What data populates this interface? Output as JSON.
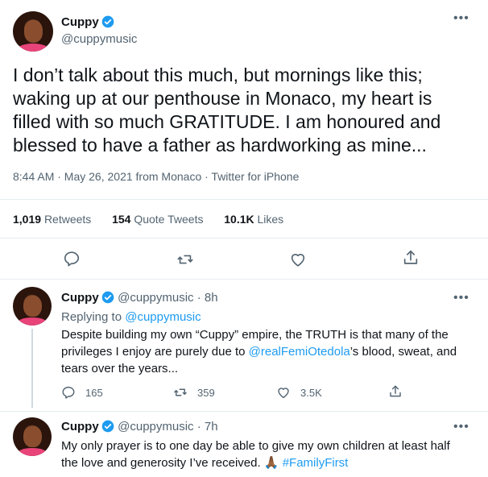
{
  "main_tweet": {
    "name": "Cuppy",
    "handle": "@cuppymusic",
    "text_lines": [
      "I don’t talk about this much, but mornings like this;",
      "waking up at our penthouse in Monaco, my heart is",
      "filled with so much GRATITUDE. I am honoured and",
      "blessed to have a father as hardworking as mine..."
    ],
    "time": "8:44 AM · May 26, 2021 from Monaco · Twitter for iPhone",
    "stats": {
      "retweets_count": "1,019",
      "retweets_label": "Retweets",
      "quotes_count": "154",
      "quotes_label": "Quote Tweets",
      "likes_count": "10.1K",
      "likes_label": "Likes"
    },
    "actions": [
      "reply-icon",
      "retweet-icon",
      "like-icon",
      "share-icon"
    ]
  },
  "reply1": {
    "name": "Cuppy",
    "handle": "@cuppymusic",
    "time": "8h",
    "replying_prefix": "Replying to",
    "replying_handle": "@cuppymusic",
    "line1": "Despite building my own “Cuppy” empire, the TRUTH is that many of the",
    "line2": "privileges I enjoy are purely due to",
    "line2_mention": "@realFemiOtedola",
    "line2_suffix": "’s blood, sweat, and",
    "line3": "tears over the years...",
    "reply_count": "165",
    "retweet_count": "359",
    "like_count": "3.5K"
  },
  "reply2": {
    "name": "Cuppy",
    "handle": "@cuppymusic",
    "time": "7h",
    "line1": "My only prayer is to one day be able to give my own children at least half",
    "line2": "the love and generosity I’ve received.",
    "emoji": "🙏🏾",
    "hashtag": "#FamilyFirst"
  },
  "colors": {
    "text": "#0f1419",
    "secondary": "#536471",
    "link": "#1d9bf0",
    "divider": "#e6ecf0"
  }
}
